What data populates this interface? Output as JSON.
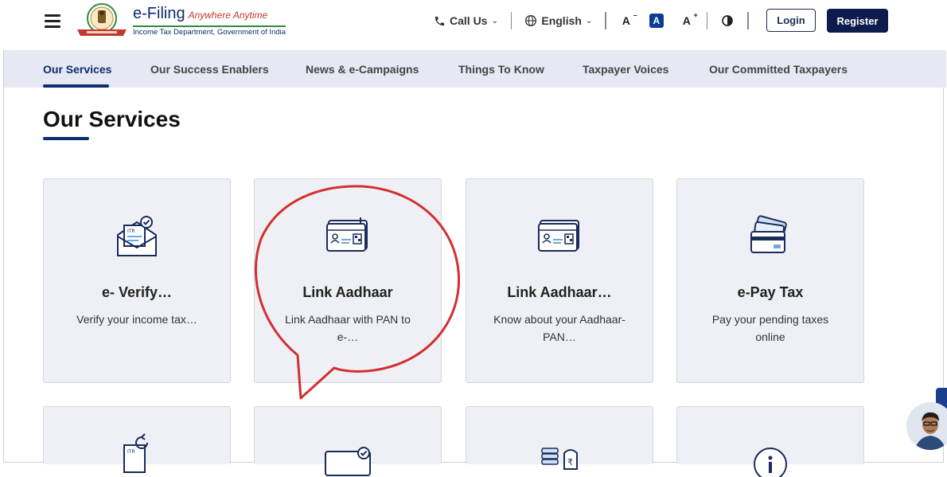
{
  "header": {
    "logo_title": "e-Filing",
    "logo_tagline": "Anywhere Anytime",
    "logo_subtitle": "Income Tax Department, Government of India",
    "call_us": "Call Us",
    "language": "English",
    "font_decrease": "A",
    "font_default": "A",
    "font_increase": "A",
    "login": "Login",
    "register": "Register"
  },
  "nav": {
    "items": [
      {
        "label": "Our Services"
      },
      {
        "label": "Our Success Enablers"
      },
      {
        "label": "News & e-Campaigns"
      },
      {
        "label": "Things To Know"
      },
      {
        "label": "Taxpayer Voices"
      },
      {
        "label": "Our Committed Taxpayers"
      }
    ]
  },
  "section": {
    "title": "Our Services"
  },
  "cards": [
    {
      "title": "e- Verify…",
      "desc": "Verify your income tax…",
      "icon": "itr-envelope-icon"
    },
    {
      "title": "Link Aadhaar",
      "desc": "Link Aadhaar with PAN to e-…",
      "icon": "aadhaar-card-icon"
    },
    {
      "title": "Link Aadhaar…",
      "desc": "Know about your Aadhaar-PAN…",
      "icon": "aadhaar-card-icon"
    },
    {
      "title": "e-Pay Tax",
      "desc": "Pay your pending taxes online",
      "icon": "credit-card-icon"
    }
  ],
  "colors": {
    "brand_navy": "#0b2e6e",
    "nav_bg": "#e6e8f3",
    "card_bg": "#eef0f5",
    "annotation_red": "#d32f2f"
  }
}
